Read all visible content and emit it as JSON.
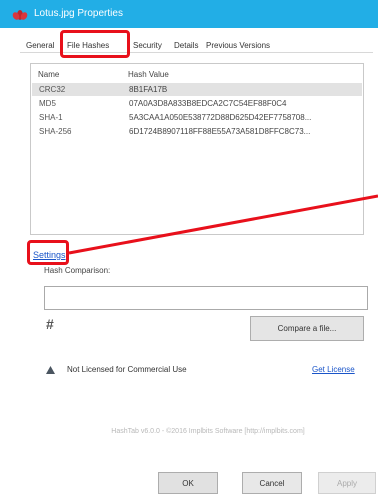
{
  "window": {
    "title": "Lotus.jpg Properties",
    "title_bar_color": "#22aee6"
  },
  "tabs": [
    {
      "label": "General"
    },
    {
      "label": "File Hashes",
      "selected": true
    },
    {
      "label": "Security"
    },
    {
      "label": "Details"
    },
    {
      "label": "Previous Versions"
    }
  ],
  "hash_list": {
    "columns": [
      "Name",
      "Hash Value"
    ],
    "rows": [
      {
        "name": "CRC32",
        "value": "8B1FA17B",
        "selected": true
      },
      {
        "name": "MD5",
        "value": "07A0A3D8A833B8EDCA2C7C54EF88F0C4"
      },
      {
        "name": "SHA-1",
        "value": "5A3CAA1A050E538772D88D625D42EF7758708..."
      },
      {
        "name": "SHA-256",
        "value": "6D1724B8907118FF88E55A73A581D8FFC8C73..."
      }
    ]
  },
  "settings_link": "Settings",
  "comparison": {
    "label": "Hash Comparison:",
    "input_value": "",
    "symbol_icon": "hash-icon",
    "compare_button": "Compare a file..."
  },
  "license": {
    "warning_icon": "warning-icon",
    "text": "Not Licensed for Commercial Use",
    "link": "Get License"
  },
  "footer": "HashTab v6.0.0 - ©2016 Implbits Software [http://implbits.com]",
  "buttons": {
    "ok": "OK",
    "cancel": "Cancel",
    "apply": "Apply"
  },
  "annotation_color": "#e8101b"
}
